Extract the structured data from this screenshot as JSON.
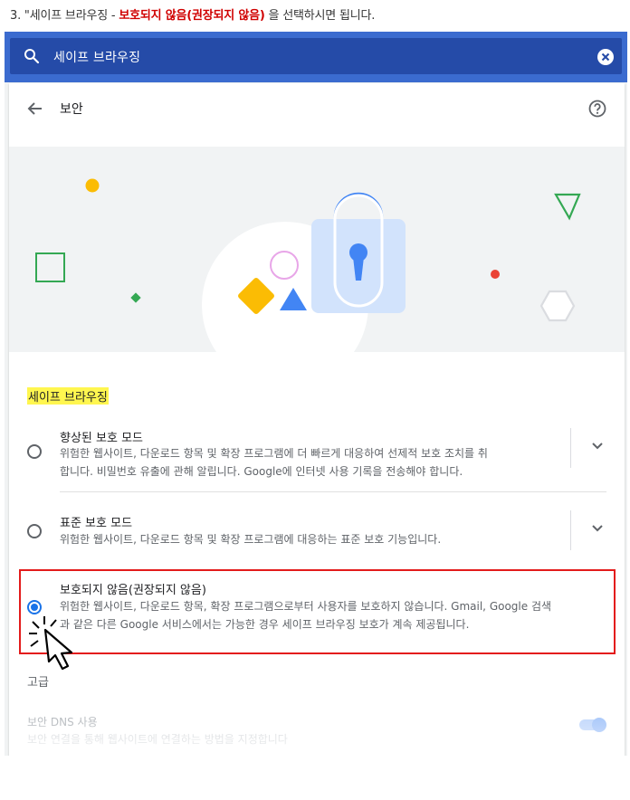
{
  "instruction": {
    "prefix": "3. \"세이프 브라우징 - ",
    "emphasis": "보호되지 않음(권장되지 않음)",
    "suffix": " 을 선택하시면 됩니다."
  },
  "search": {
    "query": "세이프 브라우징"
  },
  "header": {
    "title": "보안"
  },
  "section": {
    "heading": "세이프 브라우징"
  },
  "options": [
    {
      "label": "향상된 보호 모드",
      "desc_line1": "위험한 웹사이트, 다운로드 항목 및 확장 프로그램에 더 빠르게 대응하여 선제적 보호 조치를 취",
      "desc_line2": "합니다. 비밀번호 유출에 관해 알립니다. Google에 인터넷 사용 기록을 전송해야 합니다.",
      "selected": false
    },
    {
      "label": "표준 보호 모드",
      "desc_line1": "위험한 웹사이트, 다운로드 항목 및 확장 프로그램에 대응하는 표준 보호 기능입니다.",
      "selected": false
    },
    {
      "label": "보호되지 않음(권장되지 않음)",
      "desc_line1": "위험한 웹사이트, 다운로드 항목, 확장 프로그램으로부터 사용자를 보호하지 않습니다. Gmail, Google 검색",
      "desc_line2": "과 같은 다른 Google 서비스에서는 가능한 경우 세이프 브라우징 보호가 계속 제공됩니다.",
      "selected": true
    }
  ],
  "advanced": {
    "label": "고급",
    "dns_label": "보안 DNS 사용",
    "dns_desc": "보안 연결을 통해 웹사이트에 연결하는 방법을 지정합니다",
    "dns_enabled": true
  },
  "colors": {
    "header_bar": "#3b6bcf",
    "search_field": "#254ba8",
    "accent": "#1a73e8",
    "highlight": "#fff64f",
    "annotation": "#e31b1b",
    "instruction_emphasis": "#d00000"
  }
}
